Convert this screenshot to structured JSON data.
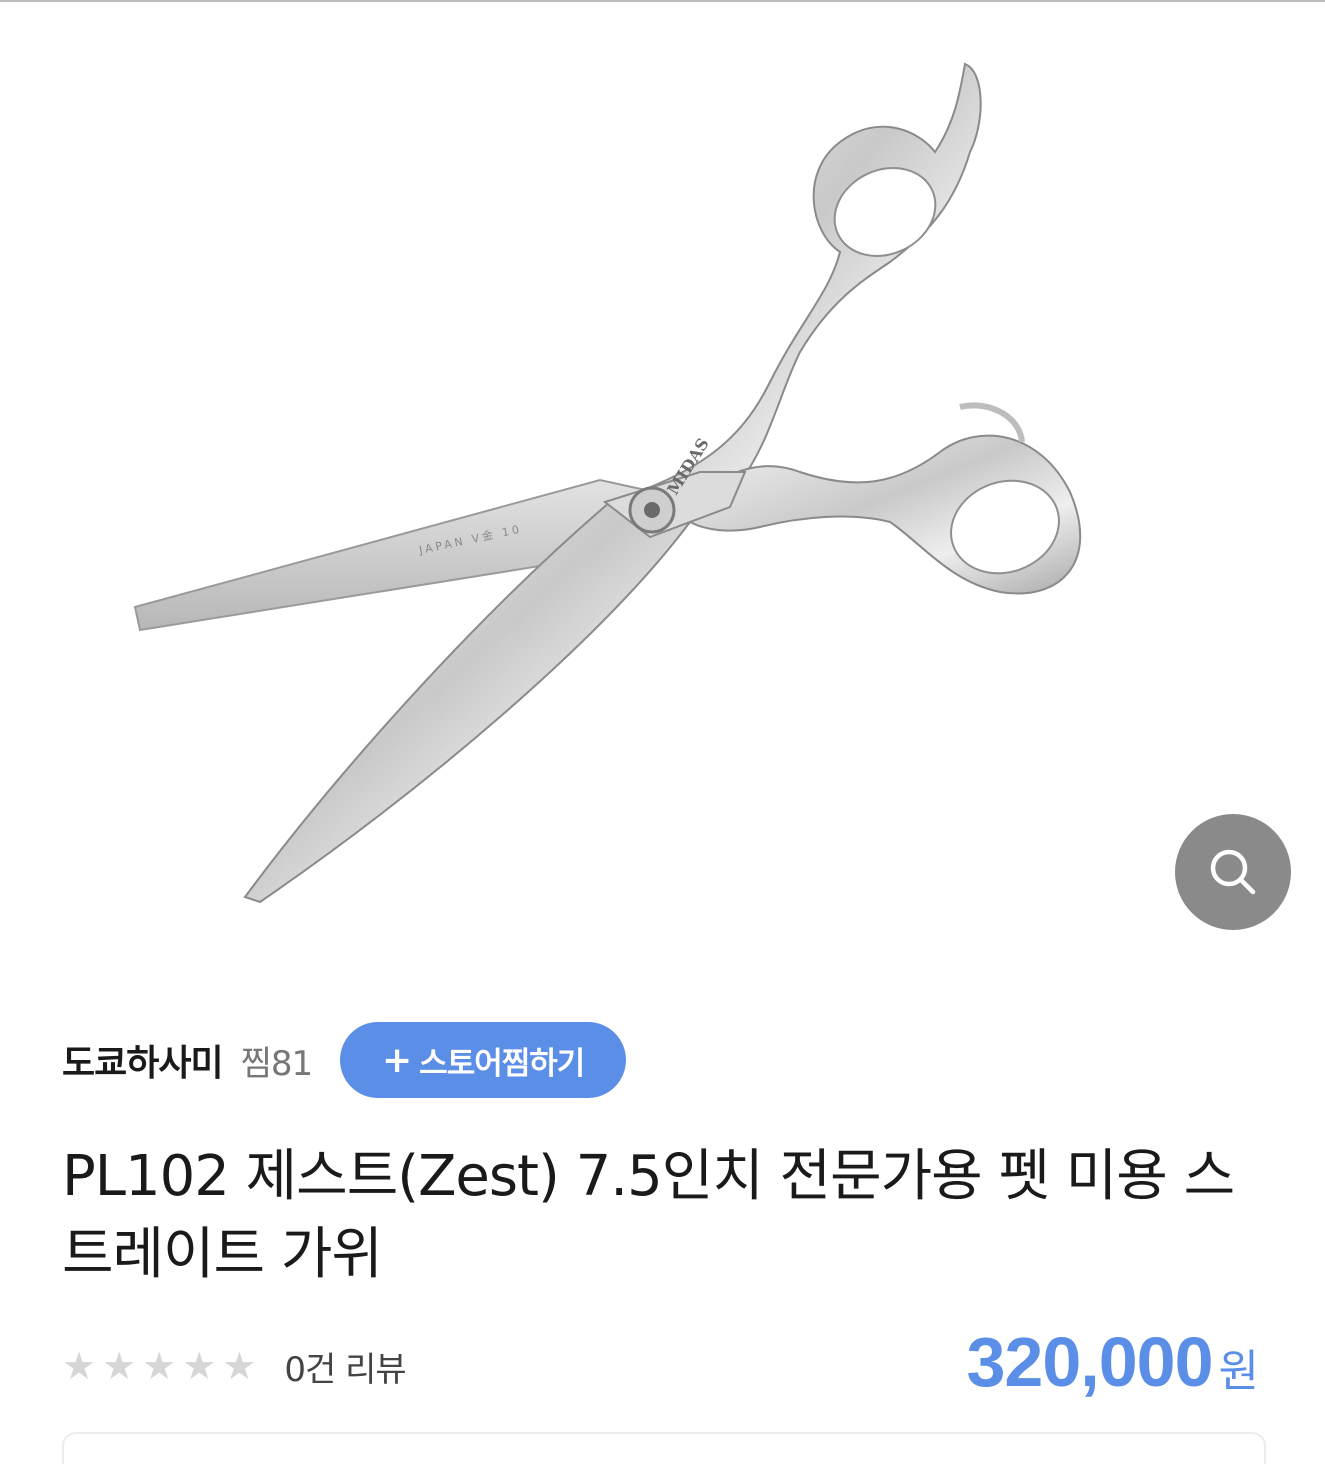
{
  "product": {
    "image_alt": "scissors",
    "engraving_brand": "MIDAS",
    "engraving_steel": "JAPAN V金 10",
    "zoom_icon": "search-icon",
    "title": "PL102 제스트(Zest) 7.5인치 전문가용 펫 미용 스트레이트 가위"
  },
  "store": {
    "name": "도쿄하사미",
    "wish_count": "찜81",
    "follow_label": "스토어찜하기",
    "follow_icon": "plus-icon"
  },
  "rating": {
    "stars": 5,
    "filled": 0,
    "review_label": "0건 리뷰"
  },
  "price": {
    "amount": "320,000",
    "unit": "원"
  },
  "colors": {
    "accent": "#5b8ee6",
    "star_empty": "#d6d6d6",
    "zoom_bg": "#8a8a8a"
  }
}
